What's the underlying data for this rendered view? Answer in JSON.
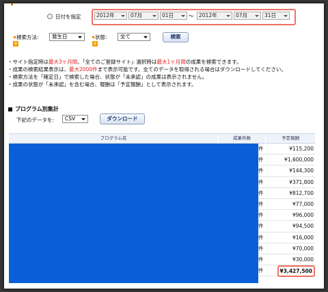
{
  "date_filter": {
    "radio_label": "日付を指定",
    "start": {
      "year": "2012年",
      "month": "07月",
      "day": "01日"
    },
    "separator": "～",
    "end": {
      "year": "2012年",
      "month": "07月",
      "day": "31日"
    }
  },
  "search": {
    "method_label": "検索方法:",
    "method_value": "発生日",
    "status_label": "状態:",
    "status_value": "全て",
    "search_button": "検索"
  },
  "notes": {
    "line1": {
      "a": "・サイト指定時は",
      "b": "最大3ヶ月間",
      "c": "、「全てのご登録サイト」選択時は",
      "d": "最大1ヶ月間",
      "e": "の成果を検索できます。"
    },
    "line2": {
      "a": "・成果の検索結果表示は、",
      "b": "最大2000件",
      "c": "まで表示可能です。全てのデータを取得される場合はダウンロードしてください。"
    },
    "line3": "・検索方法を「確定日」で検索した場合、状態が「未承認」の成果は表示されません。",
    "line4": "・成果の状態が「未承認」を含む場合、報酬は「予定報酬」として表示されます。"
  },
  "program_section": {
    "title": "プログラム別集計",
    "download_label": "下記のデータを:",
    "format_value": "CSV",
    "download_button": "ダウンロード"
  },
  "table": {
    "headers": {
      "program": "プログラム名",
      "count": "成果件数",
      "reward": "予定報酬"
    },
    "rows": [
      {
        "unit": "件",
        "amount": "¥115,200"
      },
      {
        "unit": "件",
        "amount": "¥1,600,000"
      },
      {
        "unit": "件",
        "amount": "¥144,300"
      },
      {
        "unit": "件",
        "amount": "¥371,800"
      },
      {
        "unit": "件",
        "amount": "¥812,700"
      },
      {
        "unit": "件",
        "amount": "¥77,000"
      },
      {
        "unit": "件",
        "amount": "¥96,000"
      },
      {
        "unit": "件",
        "amount": "¥94,500"
      },
      {
        "unit": "件",
        "amount": "¥16,000"
      },
      {
        "unit": "件",
        "amount": "¥70,000"
      },
      {
        "unit": "件",
        "amount": "¥30,000"
      }
    ],
    "total": {
      "unit": "件",
      "amount": "¥3,427,500"
    }
  },
  "colors": {
    "highlight": "#f07060",
    "redacted": "#0a5fd8",
    "emphasis": "#e02020"
  }
}
